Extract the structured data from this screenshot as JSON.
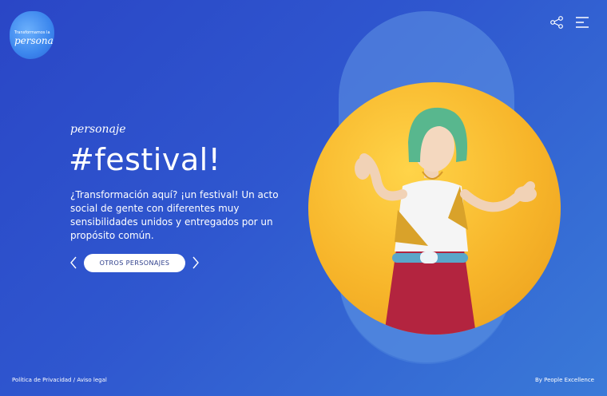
{
  "brand": {
    "logo_top": "Transformamos la",
    "logo_main": "persona"
  },
  "header": {
    "share_icon": "share-icon",
    "menu_icon": "menu-icon"
  },
  "hero": {
    "subtitle": "personaje",
    "title": "#festival!",
    "description": "¿Transformación aquí? ¡un festival! Un acto social de gente con diferentes muy sensibilidades unidos y entregados por un propósito común.",
    "cta": "OTROS PERSONAJES"
  },
  "footer": {
    "privacy": "Política de Privacidad",
    "separator": " / ",
    "legal": "Aviso legal",
    "credit": "By People Excellence"
  },
  "colors": {
    "bg_from": "#2a46c6",
    "bg_to": "#3a7ad8",
    "circle": "#f7b52a",
    "hair": "#58b78e",
    "pants": "#b3243f"
  }
}
